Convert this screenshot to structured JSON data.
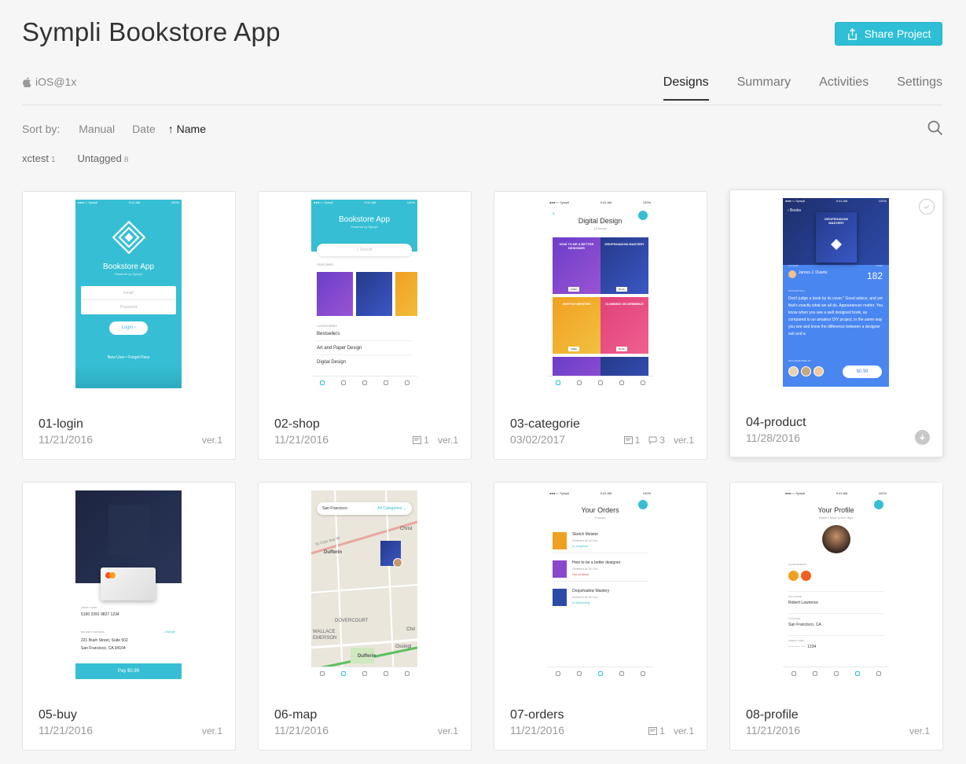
{
  "header": {
    "title": "Sympli Bookstore App",
    "share_label": "Share Project",
    "platform": "iOS@1x"
  },
  "tabs": [
    {
      "label": "Designs",
      "active": true
    },
    {
      "label": "Summary",
      "active": false
    },
    {
      "label": "Activities",
      "active": false
    },
    {
      "label": "Settings",
      "active": false
    }
  ],
  "sort": {
    "label": "Sort by:",
    "options": [
      {
        "label": "Manual"
      },
      {
        "label": "Date"
      },
      {
        "label": "Name",
        "prefix": "↑"
      }
    ]
  },
  "tags": [
    {
      "name": "xctest",
      "count": "1"
    },
    {
      "name": "Untagged",
      "count": "8"
    }
  ],
  "designs": [
    {
      "name": "01-login",
      "date": "11/21/2016",
      "version": "ver.1"
    },
    {
      "name": "02-shop",
      "date": "11/21/2016",
      "version": "ver.1",
      "notes": "1"
    },
    {
      "name": "03-categorie",
      "date": "03/02/2017",
      "version": "ver.1",
      "notes": "1",
      "comments": "3"
    },
    {
      "name": "04-product",
      "date": "11/28/2016"
    },
    {
      "name": "05-buy",
      "date": "11/21/2016",
      "version": "ver.1"
    },
    {
      "name": "06-map",
      "date": "11/21/2016",
      "version": "ver.1"
    },
    {
      "name": "07-orders",
      "date": "11/21/2016",
      "version": "ver.1",
      "notes": "1"
    },
    {
      "name": "08-profile",
      "date": "11/21/2016",
      "version": "ver.1"
    }
  ],
  "thumbs": {
    "status_carrier": "●●●○○ Sympli",
    "status_time": "9:41 AM",
    "status_battery": "100%",
    "login": {
      "app": "Bookstore App",
      "sub": "Powered by Sympli",
      "email": "Email",
      "password": "Password",
      "button": "Login ›",
      "footer": "New User  •  Forgot Pass"
    },
    "shop": {
      "app": "Bookstore App",
      "sub": "Powered by Sympli",
      "search": "⌕ Search",
      "featured": "FEATURED",
      "categories": "CATEGORIES",
      "rows": [
        "Bestsellers",
        "Art and Paper Design",
        "Digital Design"
      ]
    },
    "categorie": {
      "title": "Digital Design",
      "sub": "18 books",
      "books": [
        "HOW TO BE A BETTER DESIGNER",
        "DROPSHADOW MASTERY",
        "SKETCH MEISTER",
        "CLIMBING ON DRIBBBLE"
      ],
      "prices": [
        "FREE",
        "$0.99",
        "FREE",
        "$0.99"
      ]
    },
    "product": {
      "back": "‹ Books",
      "book": "DROPSHADOW MASTERY",
      "author_label": "AUTHOR",
      "author": "James J. Duarte",
      "likes_label": "LIKES",
      "likes": "182",
      "desc_label": "DESCRIPTION",
      "desc": "Don't judge a book by its cover.\" Good advice, and yet that's exactly what we all do. Appearances matter. You know when you see a well designed book, as compared to an amateur DIY project, in the same way you see and know the difference between a designer suit and a",
      "rec_label": "RECOMMENDED BY",
      "price": "$0.99"
    },
    "buy": {
      "card_label": "CREDIT CARD",
      "card_number": "5190  2391  9827  1234",
      "addr_label": "DELIVERY ADDRESS",
      "change": "Change",
      "addr1": "221 Bush Street, Suite 502",
      "addr2": "San Francisco, CA 94104",
      "pay": "Pay $0.99"
    },
    "map": {
      "city": "San Francisco",
      "filter": "All Categories ⌄",
      "streets": [
        "Dufferin",
        "St Clair Ave W",
        "Christ",
        "DOVERCOURT",
        "WALLACE EMERSON",
        "Dufferin",
        "Ossingt",
        "Chri"
      ]
    },
    "orders": {
      "title": "Your Orders",
      "sub": "3 books",
      "items": [
        {
          "name": "Sketch Meister",
          "ordered": "Ordered at 16 Oct",
          "status": "In progress"
        },
        {
          "name": "How to be a better designer",
          "ordered": "Ordered at 16 Oct",
          "status": "Out of stock"
        },
        {
          "name": "Dropshadow Mastery",
          "ordered": "Ordered at 16 Oct",
          "status": "In Delivering"
        }
      ]
    },
    "profile": {
      "title": "Your Profile",
      "sub": "Robert, have a nice day!",
      "ach_label": "ACHIEVEMENTS",
      "fields": [
        {
          "label": "FULL NAME",
          "value": "Robert Lawrence"
        },
        {
          "label": "LOCATION",
          "value": "San Francisco, CA"
        },
        {
          "label": "CREDIT CARD",
          "value": "····  ····  ····  1234"
        }
      ]
    },
    "tabbar": [
      "Books",
      "Map",
      "Orders",
      "Profile",
      "Help"
    ]
  },
  "colors": {
    "accent": "#2ebfd6",
    "text": "#333333",
    "muted": "#999999"
  }
}
